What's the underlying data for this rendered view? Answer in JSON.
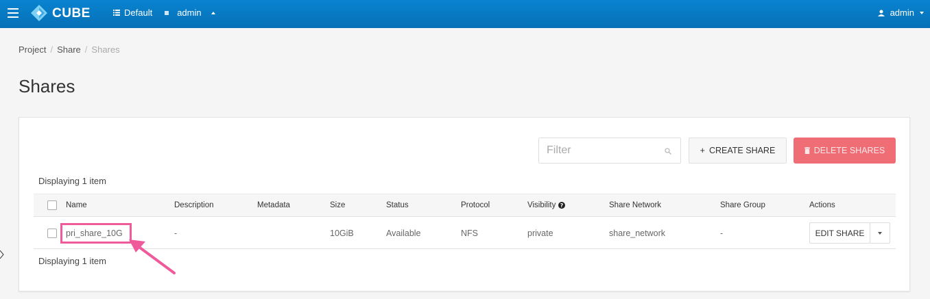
{
  "navbar": {
    "brand": "CUBE",
    "domain": "Default",
    "project": "admin",
    "user": "admin",
    "colors": {
      "bar": "#0a83d0",
      "logo": "#7fd0f5"
    }
  },
  "breadcrumb": {
    "items": [
      "Project",
      "Share",
      "Shares"
    ],
    "separator": "/"
  },
  "page": {
    "title": "Shares"
  },
  "toolbar": {
    "filter_placeholder": "Filter",
    "create_label": "CREATE SHARE",
    "create_icon": "+",
    "delete_label": "DELETE SHARES",
    "delete_color": "#ef6e76"
  },
  "table": {
    "count_top": "Displaying 1 item",
    "count_bottom": "Displaying 1 item",
    "columns": {
      "name": "Name",
      "description": "Description",
      "metadata": "Metadata",
      "size": "Size",
      "status": "Status",
      "protocol": "Protocol",
      "visibility": "Visibility",
      "share_network": "Share Network",
      "share_group": "Share Group",
      "actions": "Actions"
    },
    "rows": [
      {
        "name": "pri_share_10G",
        "description": "-",
        "metadata": "",
        "size": "10GiB",
        "status": "Available",
        "protocol": "NFS",
        "visibility": "private",
        "share_network": "share_network",
        "share_group": "-",
        "action": "EDIT SHARE"
      }
    ]
  },
  "annotation": {
    "color": "#ef5a9b"
  }
}
